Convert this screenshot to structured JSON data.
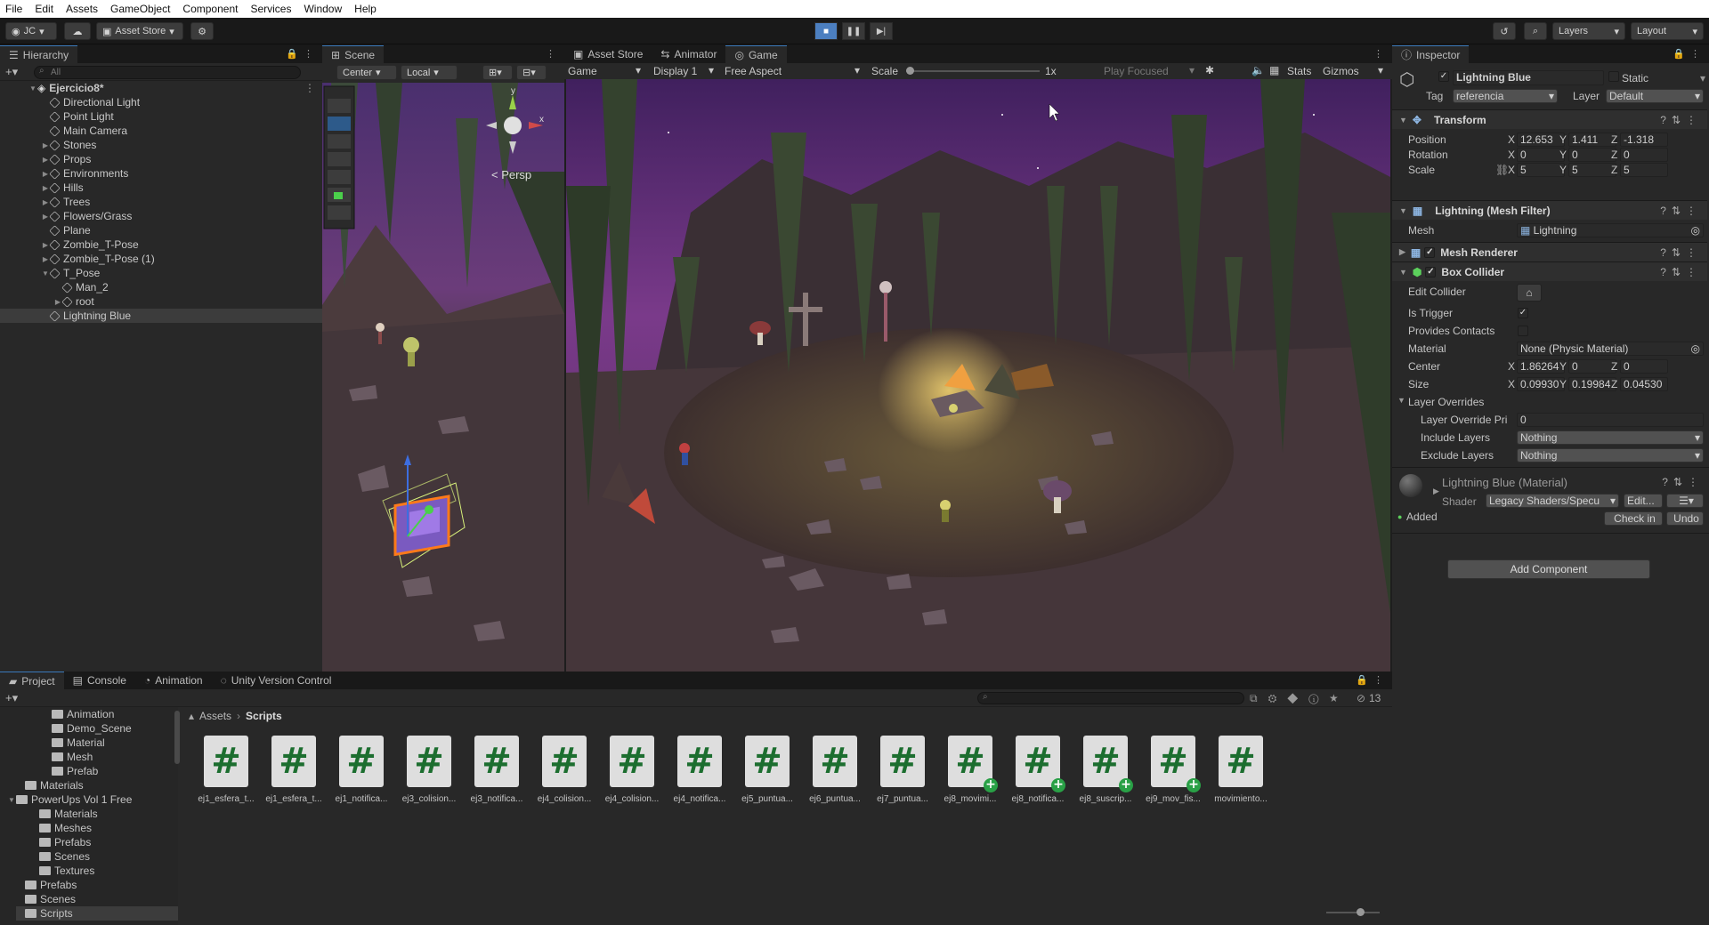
{
  "menu": [
    "File",
    "Edit",
    "Assets",
    "GameObject",
    "Component",
    "Services",
    "Window",
    "Help"
  ],
  "toolbar": {
    "account": "JC",
    "asset_store": "Asset Store",
    "layers": "Layers",
    "layout": "Layout"
  },
  "hierarchy": {
    "tab": "Hierarchy",
    "search_placeholder": "All",
    "scene": "Ejercicio8*",
    "items": [
      "Directional Light",
      "Point Light",
      "Main Camera",
      "Stones",
      "Props",
      "Environments",
      "Hills",
      "Trees",
      "Flowers/Grass",
      "Plane",
      "Zombie_T-Pose",
      "Zombie_T-Pose (1)",
      "T_Pose",
      "Man_2",
      "root",
      "Lightning Blue"
    ]
  },
  "scene": {
    "tab": "Scene",
    "pivot": "Center",
    "space": "Local",
    "persp": "< Persp",
    "gizmo_y": "y",
    "gizmo_x": "x"
  },
  "center_tabs": {
    "asset_store": "Asset Store",
    "animator": "Animator",
    "game": "Game"
  },
  "game": {
    "mode": "Game",
    "display": "Display 1",
    "aspect": "Free Aspect",
    "scale_label": "Scale",
    "scale_value": "1x",
    "play_focused": "Play Focused",
    "stats": "Stats",
    "gizmos": "Gizmos"
  },
  "inspector": {
    "tab": "Inspector",
    "object_name": "Lightning Blue",
    "static": "Static",
    "tag_label": "Tag",
    "tag": "referencia",
    "layer_label": "Layer",
    "layer": "Default",
    "transform": {
      "title": "Transform",
      "position_label": "Position",
      "rotation_label": "Rotation",
      "scale_label": "Scale",
      "position": [
        "12.653",
        "1.411",
        "-1.318"
      ],
      "rotation": [
        "0",
        "0",
        "0"
      ],
      "scale": [
        "5",
        "5",
        "5"
      ],
      "axes": [
        "X",
        "Y",
        "Z"
      ]
    },
    "mesh_filter": {
      "title": "Lightning (Mesh Filter)",
      "mesh_label": "Mesh",
      "mesh": "Lightning"
    },
    "mesh_renderer": {
      "title": "Mesh Renderer"
    },
    "box_collider": {
      "title": "Box Collider",
      "edit_collider": "Edit Collider",
      "is_trigger": "Is Trigger",
      "provides_contacts": "Provides Contacts",
      "material_label": "Material",
      "material": "None (Physic Material)",
      "center_label": "Center",
      "center": [
        "1.86264",
        "0",
        "0"
      ],
      "size_label": "Size",
      "size": [
        "0.09930",
        "0.19984",
        "0.04530"
      ],
      "layer_overrides": "Layer Overrides",
      "override_priority_label": "Layer Override Pri",
      "override_priority": "0",
      "include_label": "Include Layers",
      "include": "Nothing",
      "exclude_label": "Exclude Layers",
      "exclude": "Nothing"
    },
    "material": {
      "title": "Lightning Blue (Material)",
      "shader_label": "Shader",
      "shader": "Legacy Shaders/Specu",
      "edit": "Edit...",
      "added": "Added",
      "check_in": "Check in",
      "undo": "Undo"
    },
    "add_component": "Add Component"
  },
  "bottom_tabs": {
    "project": "Project",
    "console": "Console",
    "animation": "Animation",
    "vcs": "Unity Version Control",
    "count": "13"
  },
  "project": {
    "breadcrumb": [
      "Assets",
      "Scripts"
    ],
    "tree": [
      "Animation",
      "Demo_Scene",
      "Material",
      "Mesh",
      "Prefab",
      "Materials",
      "PowerUps Vol 1 Free",
      "Materials",
      "Meshes",
      "Prefabs",
      "Scenes",
      "Textures",
      "Prefabs",
      "Scenes",
      "Scripts"
    ],
    "scripts": [
      {
        "name": "ej1_esfera_t...",
        "added": false
      },
      {
        "name": "ej1_esfera_t...",
        "added": false
      },
      {
        "name": "ej1_notifica...",
        "added": false
      },
      {
        "name": "ej3_colision...",
        "added": false
      },
      {
        "name": "ej3_notifica...",
        "added": false
      },
      {
        "name": "ej4_colision...",
        "added": false
      },
      {
        "name": "ej4_colision...",
        "added": false
      },
      {
        "name": "ej4_notifica...",
        "added": false
      },
      {
        "name": "ej5_puntua...",
        "added": false
      },
      {
        "name": "ej6_puntua...",
        "added": false
      },
      {
        "name": "ej7_puntua...",
        "added": false
      },
      {
        "name": "ej8_movimi...",
        "added": true
      },
      {
        "name": "ej8_notifica...",
        "added": true
      },
      {
        "name": "ej8_suscrip...",
        "added": true
      },
      {
        "name": "ej9_mov_fis...",
        "added": true
      },
      {
        "name": "movimiento...",
        "added": false
      }
    ]
  },
  "colors": {
    "accent": "#3a79bb",
    "sky": "#5b2a6a",
    "ground": "#4a3a32",
    "script_green": "#1c6e2f"
  }
}
